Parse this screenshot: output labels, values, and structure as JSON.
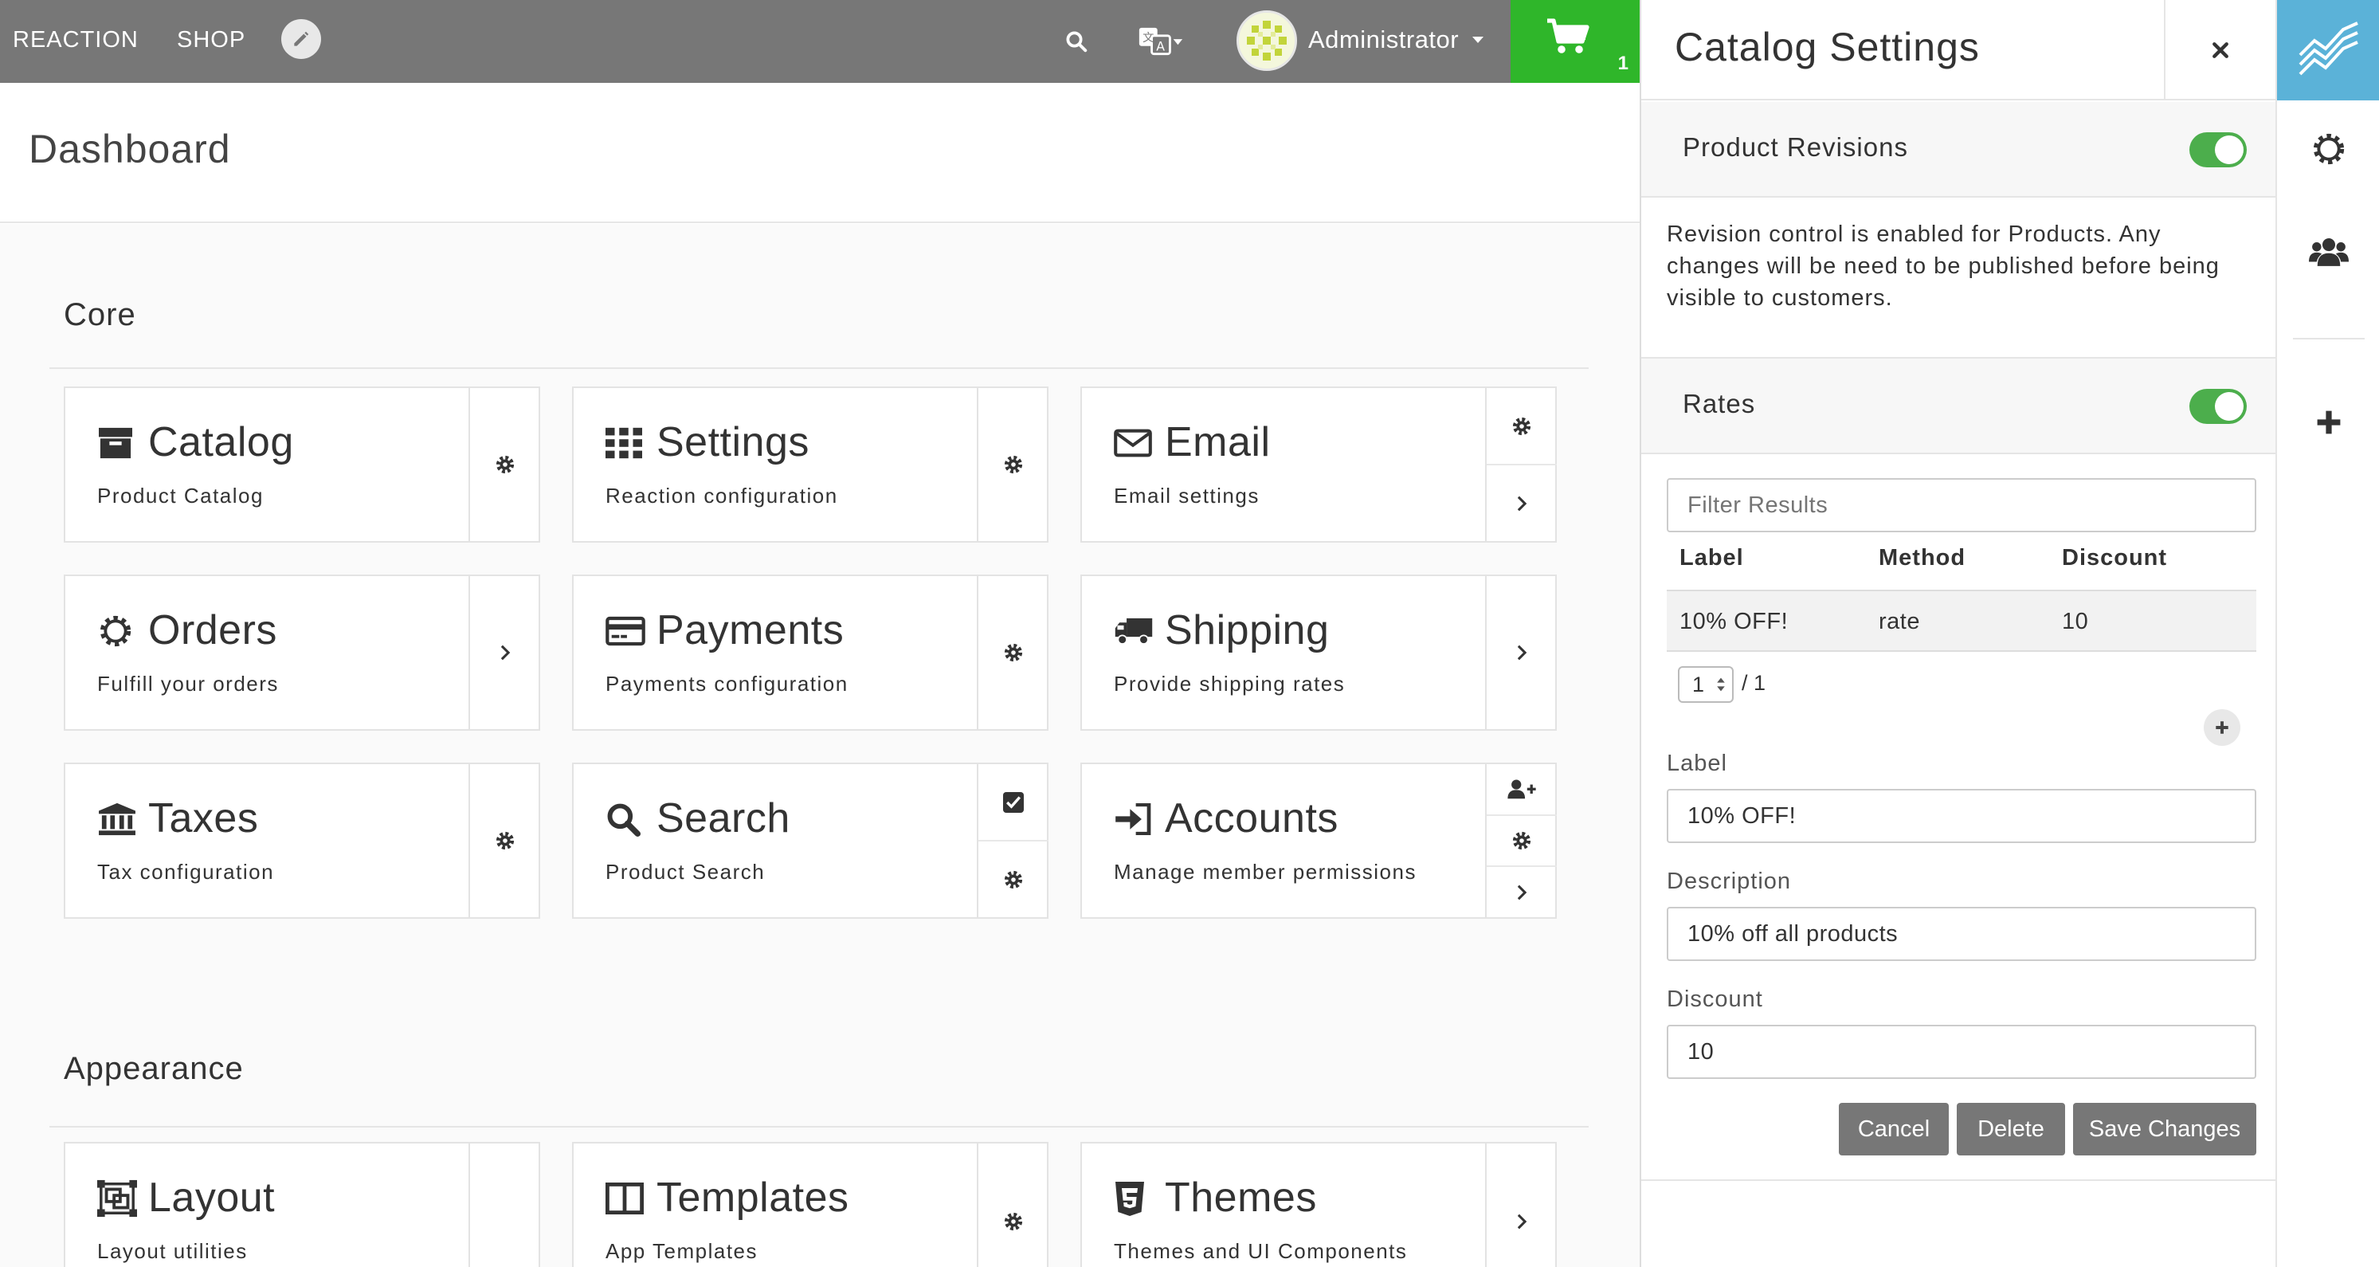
{
  "topbar": {
    "brand": "REACTION",
    "shop": "SHOP",
    "user_name": "Administrator",
    "cart_count": "1"
  },
  "dashboard": {
    "title": "Dashboard",
    "sections": {
      "core": "Core",
      "appearance": "Appearance"
    },
    "cards": {
      "catalog": {
        "title": "Catalog",
        "subtitle": "Product Catalog"
      },
      "settings": {
        "title": "Settings",
        "subtitle": "Reaction configuration"
      },
      "email": {
        "title": "Email",
        "subtitle": "Email settings"
      },
      "orders": {
        "title": "Orders",
        "subtitle": "Fulfill your orders"
      },
      "payments": {
        "title": "Payments",
        "subtitle": "Payments configuration"
      },
      "shipping": {
        "title": "Shipping",
        "subtitle": "Provide shipping rates"
      },
      "taxes": {
        "title": "Taxes",
        "subtitle": "Tax configuration"
      },
      "search": {
        "title": "Search",
        "subtitle": "Product Search"
      },
      "accounts": {
        "title": "Accounts",
        "subtitle": "Manage member permissions"
      },
      "layout": {
        "title": "Layout",
        "subtitle": "Layout utilities"
      },
      "templates": {
        "title": "Templates",
        "subtitle": "App Templates"
      },
      "themes": {
        "title": "Themes",
        "subtitle": "Themes and UI Components"
      }
    }
  },
  "panel": {
    "title": "Catalog Settings",
    "product_revisions": {
      "label": "Product Revisions",
      "enabled": true,
      "description": "Revision control is enabled for Products. Any changes will be need to be published before being visible to customers."
    },
    "rates": {
      "label": "Rates",
      "enabled": true,
      "filter_placeholder": "Filter Results",
      "columns": [
        "Label",
        "Method",
        "Discount"
      ],
      "rows": [
        {
          "label": "10% OFF!",
          "method": "rate",
          "discount": "10"
        }
      ],
      "page": "1",
      "page_total": "/ 1"
    },
    "form": {
      "label_label": "Label",
      "label_value": "10% OFF!",
      "description_label": "Description",
      "description_value": "10% off all products",
      "discount_label": "Discount",
      "discount_value": "10"
    },
    "buttons": {
      "cancel": "Cancel",
      "delete": "Delete",
      "save": "Save Changes"
    }
  },
  "colors": {
    "topbar": "#777777",
    "cart": "#2fb62a",
    "toggle_on": "#4cae4c",
    "rail_brand": "#5bb2d8",
    "button": "#777777"
  }
}
